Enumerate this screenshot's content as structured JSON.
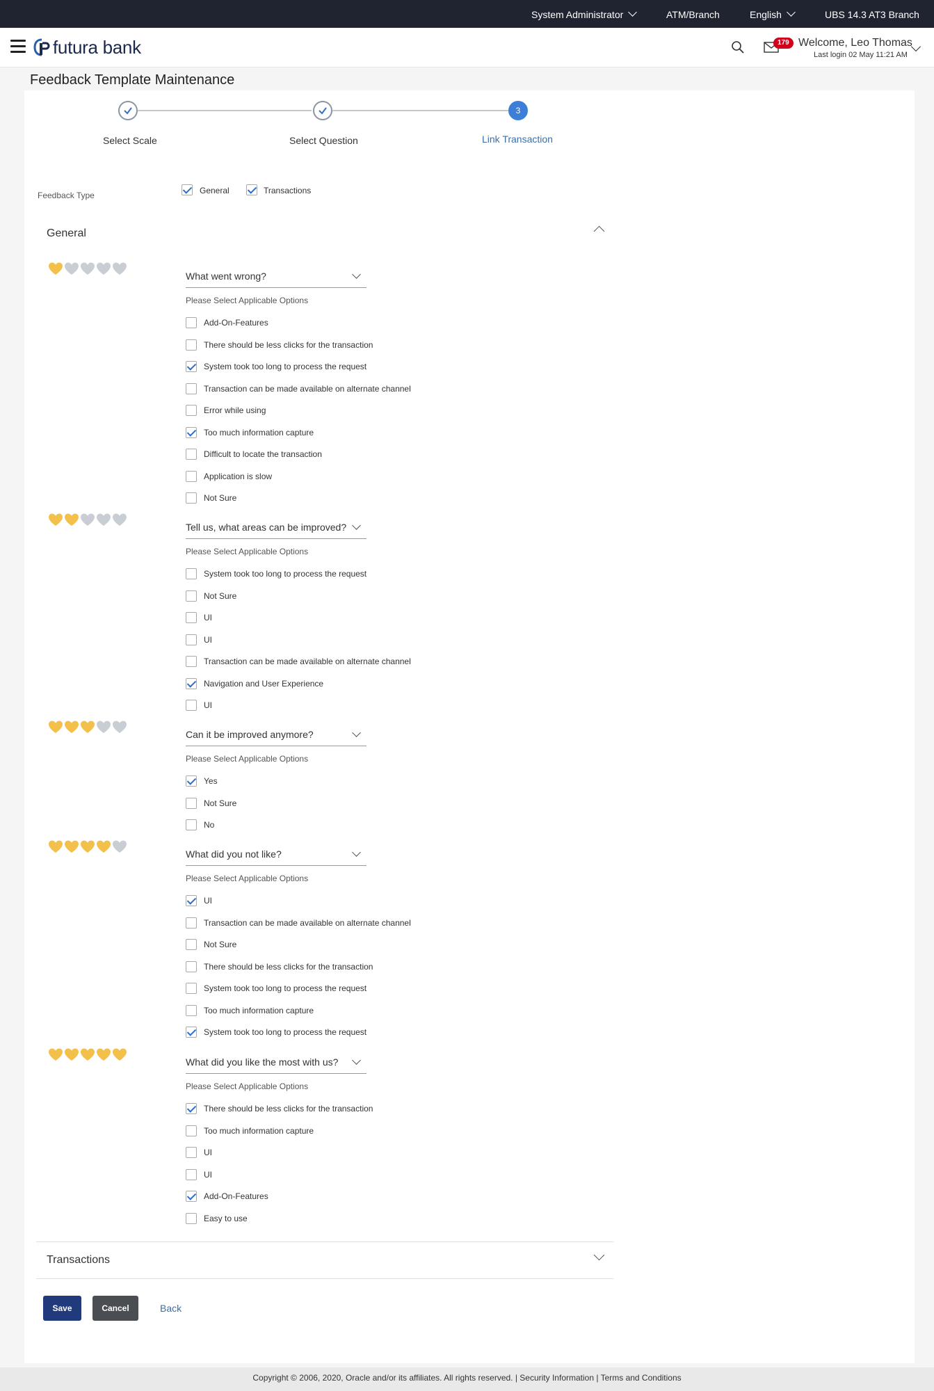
{
  "topbar": {
    "role": "System Administrator",
    "atm_branch": "ATM/Branch",
    "language": "English",
    "branch": "UBS 14.3 AT3 Branch"
  },
  "header": {
    "logo_text": "futura bank",
    "mail_count": "179",
    "welcome": "Welcome, Leo Thomas",
    "last_login": "Last login 02 May 11:21 AM"
  },
  "page_title": "Feedback Template Maintenance",
  "stepper": [
    {
      "label": "Select Scale",
      "state": "done"
    },
    {
      "label": "Select Question",
      "state": "done"
    },
    {
      "label": "Link Transaction",
      "state": "active",
      "number": "3"
    }
  ],
  "feedback_type": {
    "label": "Feedback Type",
    "options": [
      {
        "label": "General",
        "checked": true
      },
      {
        "label": "Transactions",
        "checked": true
      }
    ]
  },
  "general": {
    "title": "General",
    "applicable_label": "Please Select Applicable Options",
    "blocks": [
      {
        "rating": 1,
        "question": "What went wrong?",
        "options": [
          {
            "label": "Add-On-Features",
            "checked": false
          },
          {
            "label": "There should be less clicks for the transaction",
            "checked": false
          },
          {
            "label": "System took too long to process the request",
            "checked": true
          },
          {
            "label": "Transaction can be made available on alternate channel",
            "checked": false
          },
          {
            "label": "Error while using",
            "checked": false
          },
          {
            "label": "Too much information capture",
            "checked": true
          },
          {
            "label": "Difficult to locate the transaction",
            "checked": false
          },
          {
            "label": "Application is slow",
            "checked": false
          },
          {
            "label": "Not Sure",
            "checked": false
          }
        ]
      },
      {
        "rating": 2,
        "question": "Tell us, what areas can be improved?",
        "options": [
          {
            "label": "System took too long to process the request",
            "checked": false
          },
          {
            "label": "Not Sure",
            "checked": false
          },
          {
            "label": "UI",
            "checked": false
          },
          {
            "label": "UI",
            "checked": false
          },
          {
            "label": "Transaction can be made available on alternate channel",
            "checked": false
          },
          {
            "label": "Navigation and User Experience",
            "checked": true
          },
          {
            "label": "UI",
            "checked": false
          }
        ]
      },
      {
        "rating": 3,
        "question": "Can it be improved anymore?",
        "options": [
          {
            "label": "Yes",
            "checked": true
          },
          {
            "label": "Not Sure",
            "checked": false
          },
          {
            "label": "No",
            "checked": false
          }
        ]
      },
      {
        "rating": 4,
        "question": "What did you not like?",
        "options": [
          {
            "label": "UI",
            "checked": true
          },
          {
            "label": "Transaction can be made available on alternate channel",
            "checked": false
          },
          {
            "label": "Not Sure",
            "checked": false
          },
          {
            "label": "There should be less clicks for the transaction",
            "checked": false
          },
          {
            "label": "System took too long to process the request",
            "checked": false
          },
          {
            "label": "Too much information capture",
            "checked": false
          },
          {
            "label": "System took too long to process the request",
            "checked": true
          }
        ]
      },
      {
        "rating": 5,
        "question": "What did you like the most with us?",
        "options": [
          {
            "label": "There should be less clicks for the transaction",
            "checked": true
          },
          {
            "label": "Too much information capture",
            "checked": false
          },
          {
            "label": "UI",
            "checked": false
          },
          {
            "label": "UI",
            "checked": false
          },
          {
            "label": "Add-On-Features",
            "checked": true
          },
          {
            "label": "Easy to use",
            "checked": false
          }
        ]
      }
    ]
  },
  "transactions": {
    "title": "Transactions"
  },
  "actions": {
    "save": "Save",
    "cancel": "Cancel",
    "back": "Back"
  },
  "footer": "Copyright © 2006, 2020, Oracle and/or its affiliates. All rights reserved. | Security Information | Terms and Conditions",
  "colors": {
    "heart_on": "#f3c14b",
    "heart_off": "#c9ced4",
    "accent": "#3d7fd8",
    "save": "#203a7c"
  }
}
